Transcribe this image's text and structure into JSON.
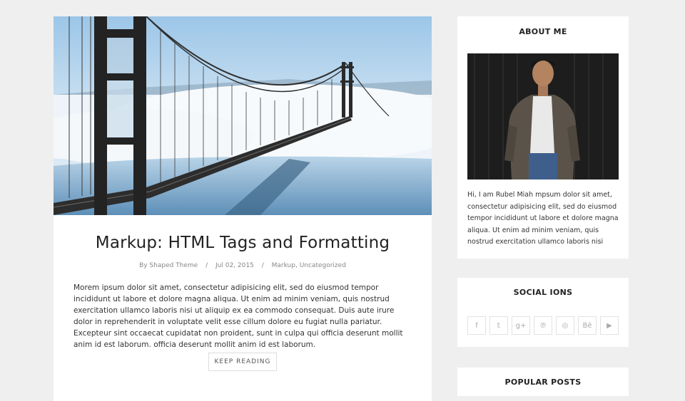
{
  "post": {
    "title": "Markup: HTML Tags and Formatting",
    "meta": {
      "author": "By  Shaped Theme",
      "date": "Jul 02, 2015",
      "categories": "Markup, Uncategorized",
      "separator": "/"
    },
    "excerpt": "Morem ipsum dolor sit amet, consectetur adipisicing elit, sed do eiusmod tempor incididunt ut labore et dolore magna aliqua. Ut enim ad minim veniam, quis nostrud exercitation ullamco laboris nisi ut aliquip ex ea commodo consequat. Duis aute irure dolor in reprehenderit in voluptate velit esse cillum dolore eu fugiat nulla pariatur. Excepteur sint occaecat cupidatat non proident, sunt in culpa qui officia deserunt mollit anim id est laborum. officia deserunt mollit anim id est laborum.",
    "read_more": "KEEP READING"
  },
  "sidebar": {
    "about": {
      "title": "ABOUT ME",
      "text": "Hi, I am Rubel Miah mpsum dolor sit amet, consectetur adipisicing elit, sed do eiusmod tempor incididunt ut labore et dolore magna aliqua. Ut enim ad minim veniam, quis nostrud exercitation ullamco laboris nisi"
    },
    "social": {
      "title": "SOCIAL IONS",
      "icons": [
        {
          "name": "facebook-icon",
          "glyph": "f"
        },
        {
          "name": "twitter-icon",
          "glyph": "𝕥"
        },
        {
          "name": "google-plus-icon",
          "glyph": "g+"
        },
        {
          "name": "pinterest-icon",
          "glyph": "℗"
        },
        {
          "name": "dribbble-icon",
          "glyph": "◎"
        },
        {
          "name": "behance-icon",
          "glyph": "Bē"
        },
        {
          "name": "youtube-icon",
          "glyph": "▶"
        }
      ]
    },
    "popular": {
      "title": "POPULAR POSTS"
    }
  }
}
